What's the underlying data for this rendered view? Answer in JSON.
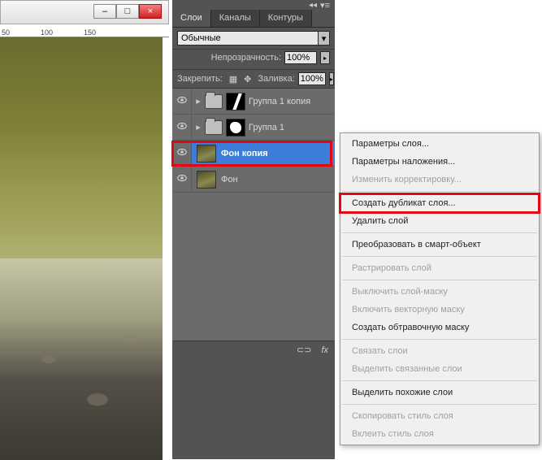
{
  "window": {
    "min_label": "–",
    "max_label": "□",
    "close_label": "×"
  },
  "ruler": {
    "marks": [
      "50",
      "100",
      "150"
    ]
  },
  "panel": {
    "tabs": {
      "layers": "Слои",
      "channels": "Каналы",
      "paths": "Контуры"
    },
    "blend_mode": "Обычные",
    "opacity_label": "Непрозрачность:",
    "opacity_value": "100%",
    "lock_label": "Закрепить:",
    "fill_label": "Заливка:",
    "fill_value": "100%"
  },
  "layers": [
    {
      "name": "Группа 1 копия",
      "type": "group-mask1"
    },
    {
      "name": "Группа 1",
      "type": "group-mask2"
    },
    {
      "name": "Фон копия",
      "type": "image",
      "selected": true
    },
    {
      "name": "Фон",
      "type": "image"
    }
  ],
  "footer": {
    "link": "⊂⊃",
    "fx": "fx"
  },
  "context_menu": {
    "items": [
      {
        "label": "Параметры слоя...",
        "enabled": true
      },
      {
        "label": "Параметры наложения...",
        "enabled": true
      },
      {
        "label": "Изменить корректировку...",
        "enabled": false
      },
      {
        "sep": true
      },
      {
        "label": "Создать дубликат слоя...",
        "enabled": true,
        "highlighted": true
      },
      {
        "label": "Удалить слой",
        "enabled": true
      },
      {
        "sep": true
      },
      {
        "label": "Преобразовать в смарт-объект",
        "enabled": true
      },
      {
        "sep": true
      },
      {
        "label": "Растрировать слой",
        "enabled": false
      },
      {
        "sep": true
      },
      {
        "label": "Выключить слой-маску",
        "enabled": false
      },
      {
        "label": "Включить векторную маску",
        "enabled": false
      },
      {
        "label": "Создать обтравочную маску",
        "enabled": true
      },
      {
        "sep": true
      },
      {
        "label": "Связать слои",
        "enabled": false
      },
      {
        "label": "Выделить связанные слои",
        "enabled": false
      },
      {
        "sep": true
      },
      {
        "label": "Выделить похожие слои",
        "enabled": true
      },
      {
        "sep": true
      },
      {
        "label": "Скопировать стиль слоя",
        "enabled": false
      },
      {
        "label": "Вклеить стиль слоя",
        "enabled": false
      }
    ]
  }
}
